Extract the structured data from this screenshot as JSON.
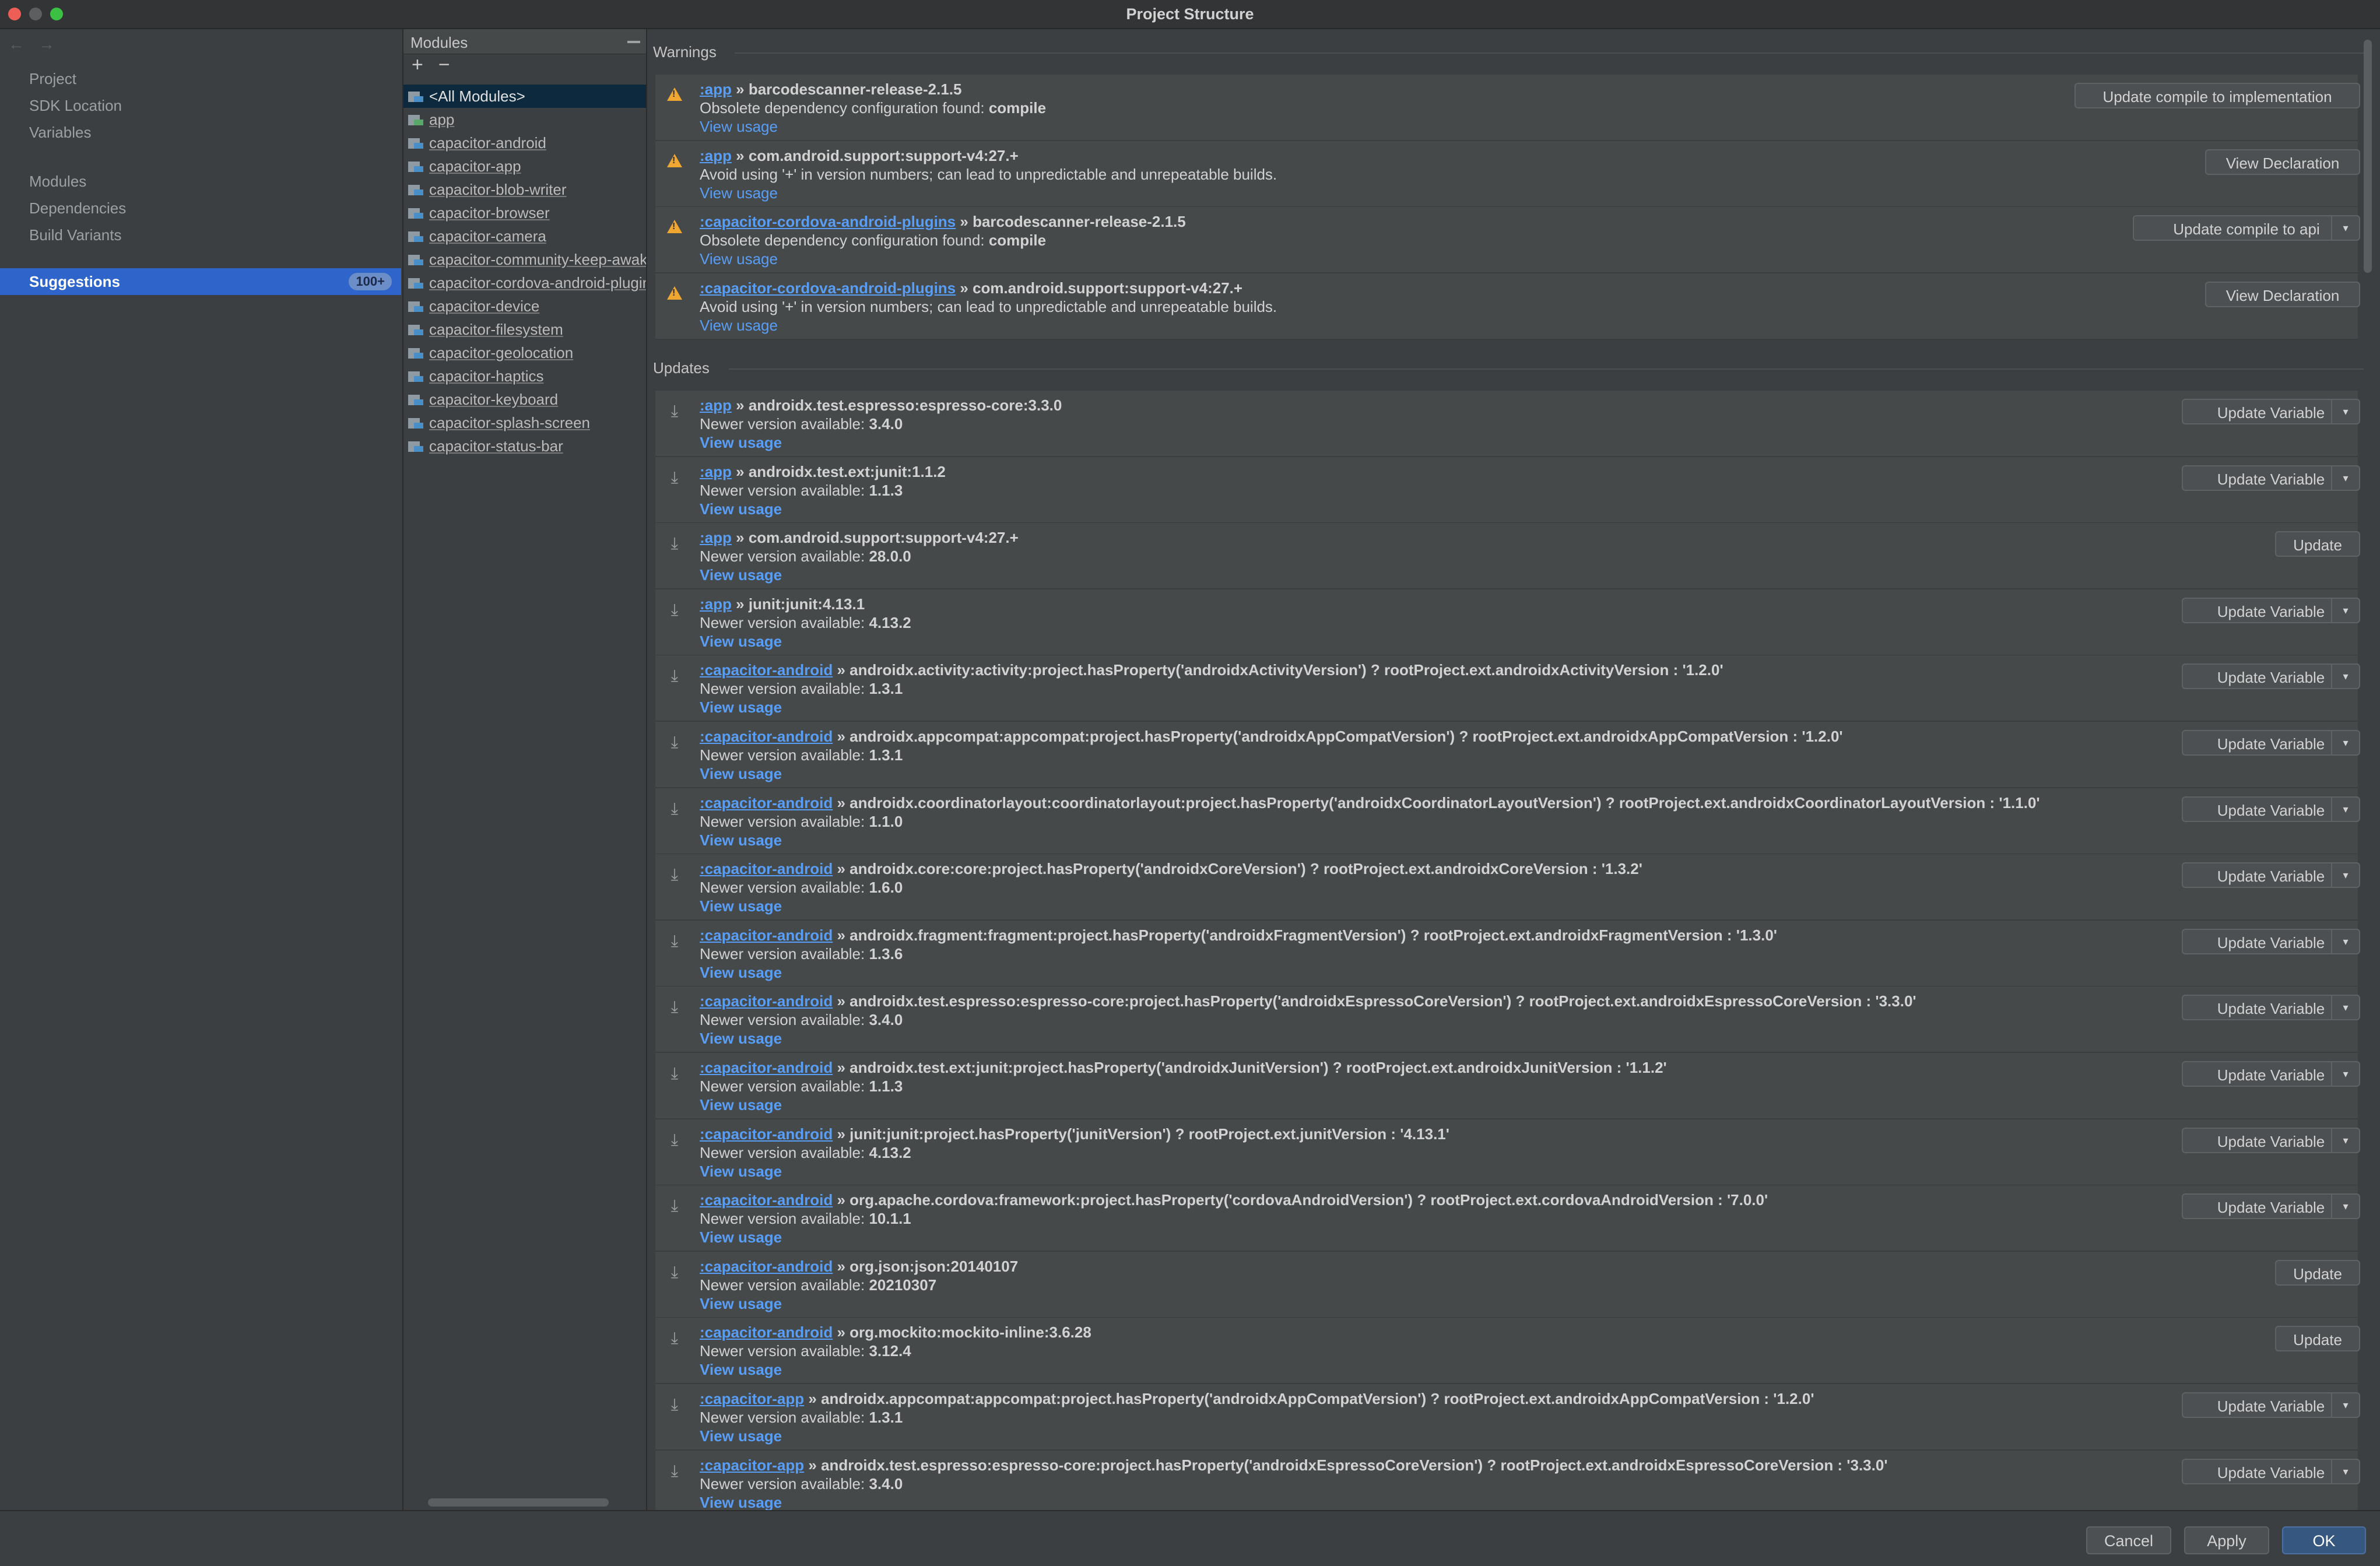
{
  "window": {
    "title": "Project Structure"
  },
  "nav": {
    "back": "←",
    "forward": "→",
    "items": [
      "Project",
      "SDK Location",
      "Variables",
      "Modules",
      "Dependencies",
      "Build Variants"
    ],
    "selected": {
      "label": "Suggestions",
      "badge": "100+"
    }
  },
  "modules": {
    "title": "Modules",
    "add": "+",
    "remove": "−",
    "items": [
      "<All Modules>",
      "app",
      "capacitor-android",
      "capacitor-app",
      "capacitor-blob-writer",
      "capacitor-browser",
      "capacitor-camera",
      "capacitor-community-keep-awake",
      "capacitor-cordova-android-plugins",
      "capacitor-device",
      "capacitor-filesystem",
      "capacitor-geolocation",
      "capacitor-haptics",
      "capacitor-keyboard",
      "capacitor-splash-screen",
      "capacitor-status-bar"
    ]
  },
  "warnings": {
    "title": "Warnings",
    "items": [
      {
        "module": ":app",
        "sep": " » ",
        "dep": "barcodescanner-release-2.1.5",
        "msg": "Obsolete dependency configuration found: ",
        "msg_bold": "compile",
        "link": "View usage",
        "button": "Update compile to implementation",
        "split": false
      },
      {
        "module": ":app",
        "sep": " » ",
        "dep": "com.android.support:support-v4:27.+",
        "msg": "Avoid using '+' in version numbers; can lead to unpredictable and unrepeatable builds.",
        "msg_bold": "",
        "link": "View usage",
        "button": "View Declaration",
        "split": false
      },
      {
        "module": ":capacitor-cordova-android-plugins",
        "sep": " » ",
        "dep": "barcodescanner-release-2.1.5",
        "msg": "Obsolete dependency configuration found: ",
        "msg_bold": "compile",
        "link": "View usage",
        "button": "Update compile to api",
        "split": true
      },
      {
        "module": ":capacitor-cordova-android-plugins",
        "sep": " » ",
        "dep": "com.android.support:support-v4:27.+",
        "msg": "Avoid using '+' in version numbers; can lead to unpredictable and unrepeatable builds.",
        "msg_bold": "",
        "link": "View usage",
        "button": "View Declaration",
        "split": false
      }
    ]
  },
  "updates": {
    "title": "Updates",
    "prefix": "Newer version available: ",
    "link": "View usage",
    "items": [
      {
        "module": ":app",
        "sep": " » ",
        "dep": "androidx.test.espresso:espresso-core:3.3.0",
        "version": "3.4.0",
        "button": "Update Variable",
        "split": true
      },
      {
        "module": ":app",
        "sep": " » ",
        "dep": "androidx.test.ext:junit:1.1.2",
        "version": "1.1.3",
        "button": "Update Variable",
        "split": true
      },
      {
        "module": ":app",
        "sep": " » ",
        "dep": "com.android.support:support-v4:27.+",
        "version": "28.0.0",
        "button": "Update",
        "split": false
      },
      {
        "module": ":app",
        "sep": " » ",
        "dep": "junit:junit:4.13.1",
        "version": "4.13.2",
        "button": "Update Variable",
        "split": true
      },
      {
        "module": ":capacitor-android",
        "sep": " » ",
        "dep": "androidx.activity:activity:project.hasProperty('androidxActivityVersion') ? rootProject.ext.androidxActivityVersion : '1.2.0'",
        "version": "1.3.1",
        "button": "Update Variable",
        "split": true
      },
      {
        "module": ":capacitor-android",
        "sep": " » ",
        "dep": "androidx.appcompat:appcompat:project.hasProperty('androidxAppCompatVersion') ? rootProject.ext.androidxAppCompatVersion : '1.2.0'",
        "version": "1.3.1",
        "button": "Update Variable",
        "split": true
      },
      {
        "module": ":capacitor-android",
        "sep": " » ",
        "dep": "androidx.coordinatorlayout:coordinatorlayout:project.hasProperty('androidxCoordinatorLayoutVersion') ? rootProject.ext.androidxCoordinatorLayoutVersion : '1.1.0'",
        "version": "1.1.0",
        "button": "Update Variable",
        "split": true
      },
      {
        "module": ":capacitor-android",
        "sep": " » ",
        "dep": "androidx.core:core:project.hasProperty('androidxCoreVersion') ? rootProject.ext.androidxCoreVersion : '1.3.2'",
        "version": "1.6.0",
        "button": "Update Variable",
        "split": true
      },
      {
        "module": ":capacitor-android",
        "sep": " » ",
        "dep": "androidx.fragment:fragment:project.hasProperty('androidxFragmentVersion') ? rootProject.ext.androidxFragmentVersion : '1.3.0'",
        "version": "1.3.6",
        "button": "Update Variable",
        "split": true
      },
      {
        "module": ":capacitor-android",
        "sep": " » ",
        "dep": "androidx.test.espresso:espresso-core:project.hasProperty('androidxEspressoCoreVersion') ? rootProject.ext.androidxEspressoCoreVersion : '3.3.0'",
        "version": "3.4.0",
        "button": "Update Variable",
        "split": true
      },
      {
        "module": ":capacitor-android",
        "sep": " » ",
        "dep": "androidx.test.ext:junit:project.hasProperty('androidxJunitVersion') ? rootProject.ext.androidxJunitVersion : '1.1.2'",
        "version": "1.1.3",
        "button": "Update Variable",
        "split": true
      },
      {
        "module": ":capacitor-android",
        "sep": " » ",
        "dep": "junit:junit:project.hasProperty('junitVersion') ? rootProject.ext.junitVersion : '4.13.1'",
        "version": "4.13.2",
        "button": "Update Variable",
        "split": true
      },
      {
        "module": ":capacitor-android",
        "sep": " » ",
        "dep": "org.apache.cordova:framework:project.hasProperty('cordovaAndroidVersion') ? rootProject.ext.cordovaAndroidVersion : '7.0.0'",
        "version": "10.1.1",
        "button": "Update Variable",
        "split": true
      },
      {
        "module": ":capacitor-android",
        "sep": " » ",
        "dep": "org.json:json:20140107",
        "version": "20210307",
        "button": "Update",
        "split": false
      },
      {
        "module": ":capacitor-android",
        "sep": " » ",
        "dep": "org.mockito:mockito-inline:3.6.28",
        "version": "3.12.4",
        "button": "Update",
        "split": false
      },
      {
        "module": ":capacitor-app",
        "sep": " » ",
        "dep": "androidx.appcompat:appcompat:project.hasProperty('androidxAppCompatVersion') ? rootProject.ext.androidxAppCompatVersion : '1.2.0'",
        "version": "1.3.1",
        "button": "Update Variable",
        "split": true
      },
      {
        "module": ":capacitor-app",
        "sep": " » ",
        "dep": "androidx.test.espresso:espresso-core:project.hasProperty('androidxEspressoCoreVersion') ? rootProject.ext.androidxEspressoCoreVersion : '3.3.0'",
        "version": "3.4.0",
        "button": "Update Variable",
        "split": true
      }
    ]
  },
  "footer": {
    "cancel": "Cancel",
    "apply": "Apply",
    "ok": "OK"
  }
}
